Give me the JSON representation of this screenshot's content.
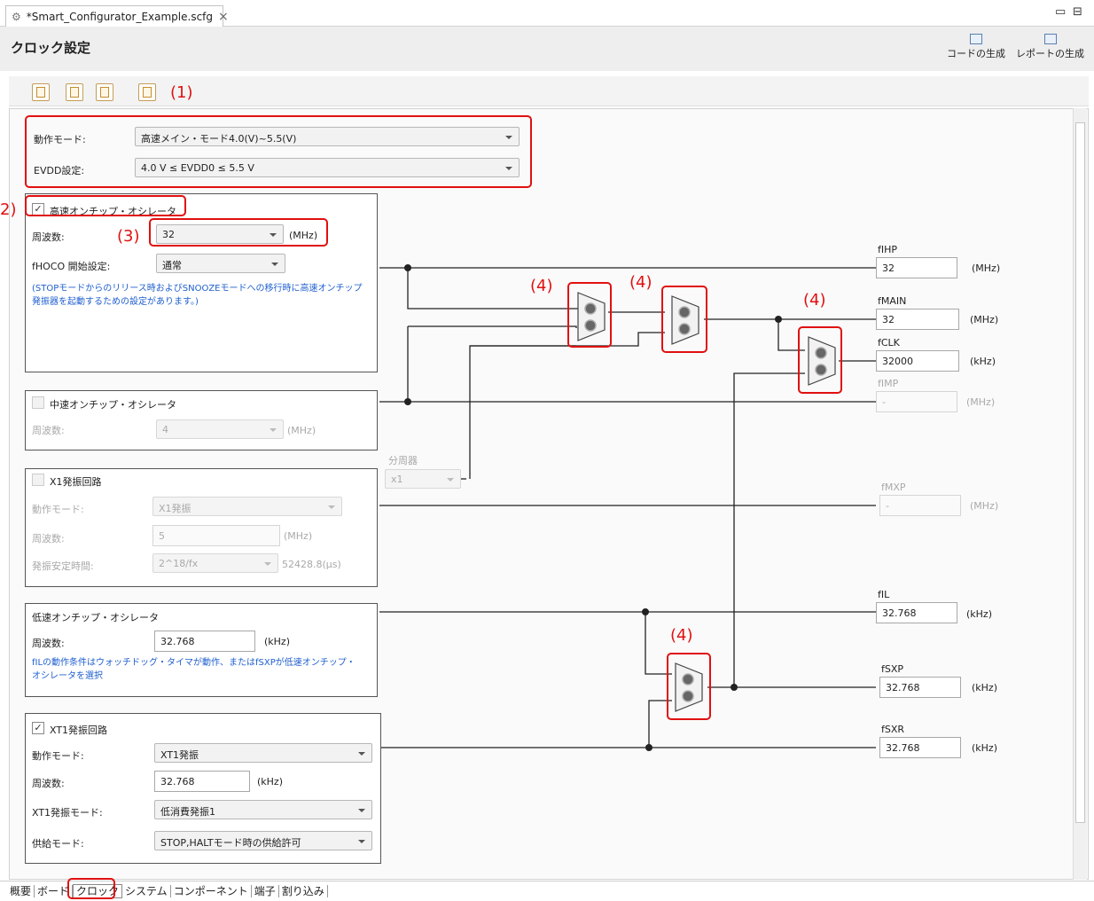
{
  "file_tab": {
    "label": "*Smart_Configurator_Example.scfg",
    "close": "×"
  },
  "window": {
    "minimize": "▭",
    "maximize": "⊟"
  },
  "page_title": "クロック設定",
  "header_buttons": {
    "generate_code": "コードの生成",
    "generate_report": "レポートの生成"
  },
  "annotations": {
    "one": "(1)",
    "two": "2)",
    "three": "(3)",
    "four": "(4)"
  },
  "mode": {
    "operation_label": "動作モード:",
    "operation_value": "高速メイン・モード4.0(V)~5.5(V)",
    "evdd_label": "EVDD設定:",
    "evdd_value": "4.0 V ≤ EVDD0 ≤ 5.5 V"
  },
  "hoco": {
    "title": "高速オンチップ・オシレータ",
    "checked": true,
    "freq_label": "周波数:",
    "freq_value": "32",
    "freq_unit": "(MHz)",
    "start_label": "fHOCO 開始設定:",
    "start_value": "通常",
    "note": "(STOPモードからのリリース時およびSNOOZEモードへの移行時に高速オンチップ発振器を起動するための設定があります。)"
  },
  "moco": {
    "title": "中速オンチップ・オシレータ",
    "checked": false,
    "freq_label": "周波数:",
    "freq_value": "4",
    "freq_unit": "(MHz)"
  },
  "divider": {
    "label": "分周器",
    "value": "x1"
  },
  "x1": {
    "title": "X1発振回路",
    "checked": false,
    "mode_label": "動作モード:",
    "mode_value": "X1発振",
    "freq_label": "周波数:",
    "freq_value": "5",
    "freq_unit": "(MHz)",
    "stab_label": "発振安定時間:",
    "stab_value": "2^18/fx",
    "stab_result": "52428.8(μs)"
  },
  "loco": {
    "title": "低速オンチップ・オシレータ",
    "freq_label": "周波数:",
    "freq_value": "32.768",
    "freq_unit": "(kHz)",
    "note": "fILの動作条件はウォッチドッグ・タイマが動作、またはfSXPが低速オンチップ・オシレータを選択"
  },
  "xt1": {
    "title": "XT1発振回路",
    "checked": true,
    "mode_label": "動作モード:",
    "mode_value": "XT1発振",
    "freq_label": "周波数:",
    "freq_value": "32.768",
    "freq_unit": "(kHz)",
    "xtmode_label": "XT1発振モード:",
    "xtmode_value": "低消費発振1",
    "supply_label": "供給モード:",
    "supply_value": "STOP,HALTモード時の供給許可"
  },
  "outputs": {
    "fihp": {
      "label": "fIHP",
      "value": "32",
      "unit": "(MHz)"
    },
    "fmain": {
      "label": "fMAIN",
      "value": "32",
      "unit": "(MHz)"
    },
    "fclk": {
      "label": "fCLK",
      "value": "32000",
      "unit": "(kHz)"
    },
    "fimp": {
      "label": "fIMP",
      "value": "-",
      "unit": "(MHz)"
    },
    "fmxp": {
      "label": "fMXP",
      "value": "-",
      "unit": "(MHz)"
    },
    "fil": {
      "label": "fIL",
      "value": "32.768",
      "unit": "(kHz)"
    },
    "fsxp": {
      "label": "fSXP",
      "value": "32.768",
      "unit": "(kHz)"
    },
    "fsxr": {
      "label": "fSXR",
      "value": "32.768",
      "unit": "(kHz)"
    }
  },
  "bottom_tabs": [
    "概要",
    "ボード",
    "クロック",
    "システム",
    "コンポーネント",
    "端子",
    "割り込み"
  ],
  "colors": {
    "highlight": "#e01010",
    "note_text": "#1f5fcf"
  }
}
